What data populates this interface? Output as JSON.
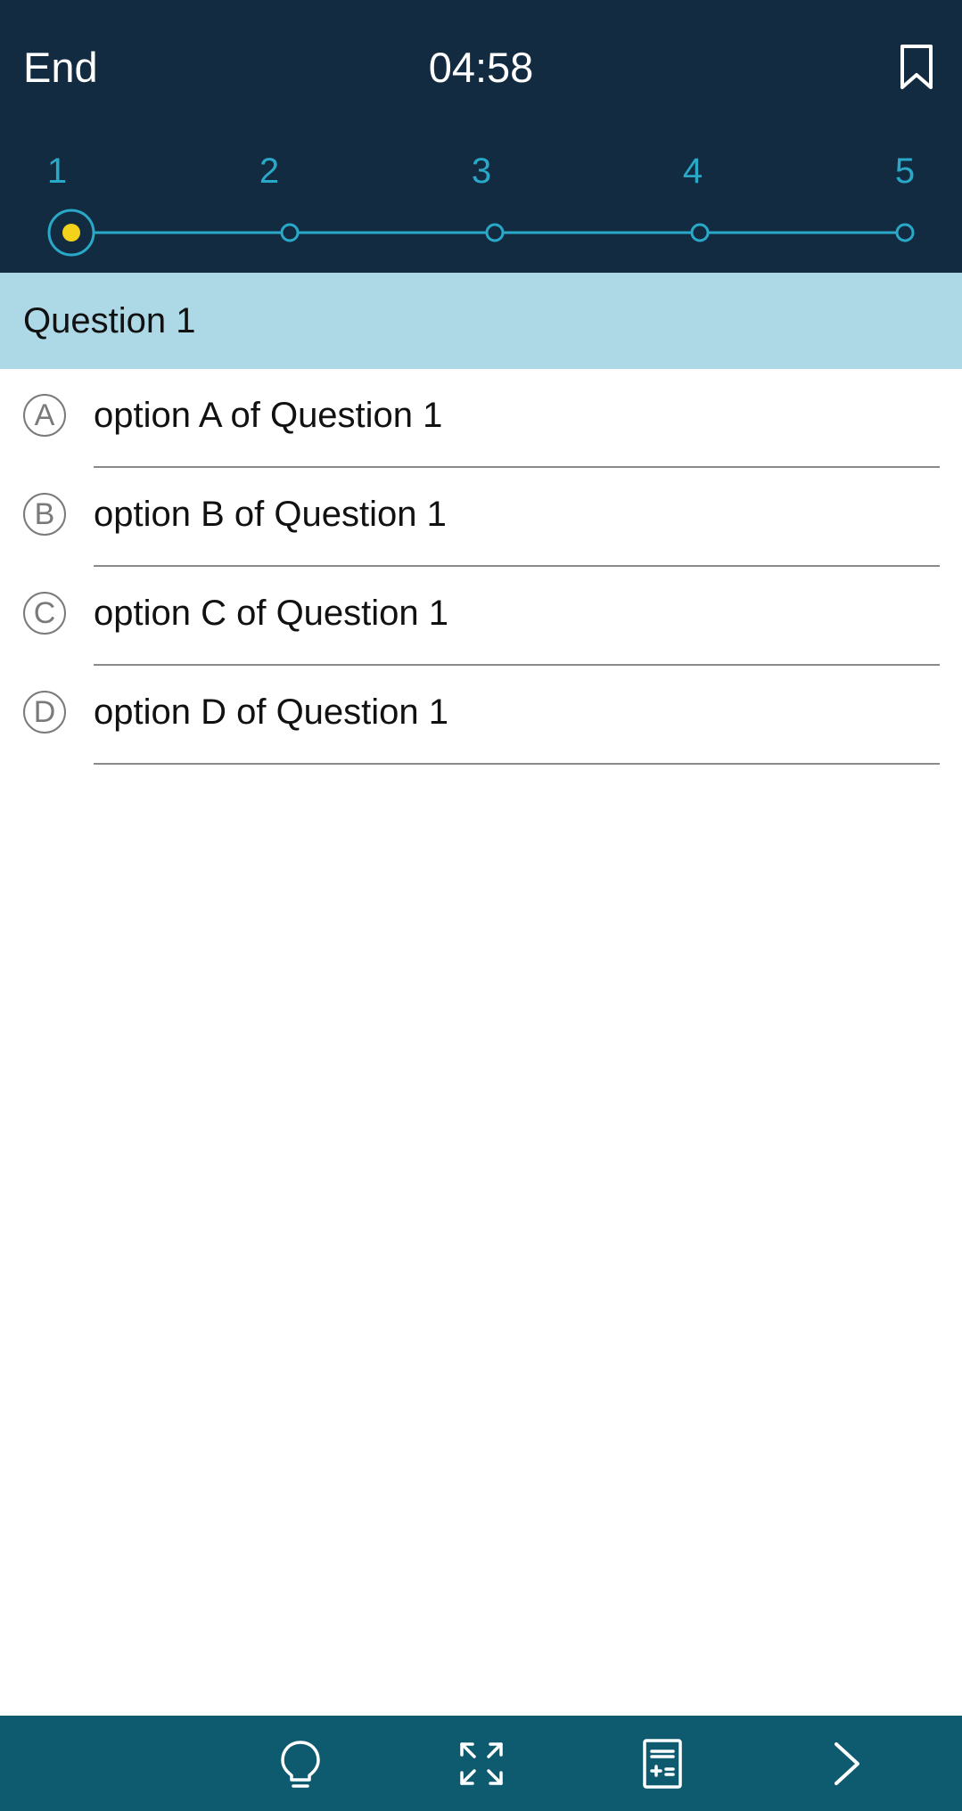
{
  "header": {
    "end_label": "End",
    "timer": "04:58",
    "bookmark_icon": "bookmark-icon"
  },
  "progress": {
    "steps": [
      "1",
      "2",
      "3",
      "4",
      "5"
    ],
    "current_step": 1,
    "colors": {
      "track": "#29a8c8",
      "current_fill": "#f2d21b"
    }
  },
  "question": {
    "title": "Question 1",
    "options": [
      {
        "letter": "A",
        "text": "option A of Question 1"
      },
      {
        "letter": "B",
        "text": "option B of Question 1"
      },
      {
        "letter": "C",
        "text": "option C of Question 1"
      },
      {
        "letter": "D",
        "text": "option D of Question 1"
      }
    ]
  },
  "toolbar": {
    "icons": [
      "lightbulb-icon",
      "expand-icon",
      "calculator-icon",
      "chevron-right-icon"
    ]
  },
  "colors": {
    "header_bg": "#122b40",
    "question_bg": "#add8e6",
    "toolbar_bg": "#0e5a6f"
  }
}
